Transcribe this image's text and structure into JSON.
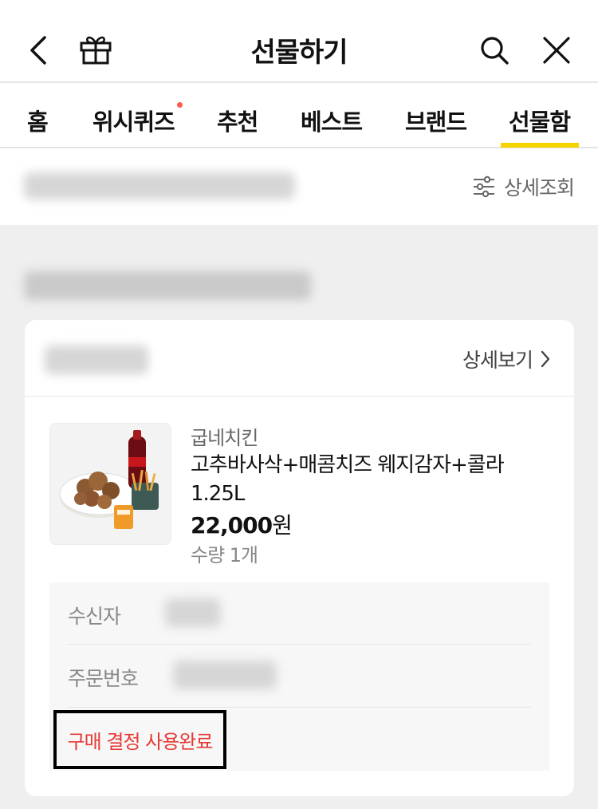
{
  "header": {
    "title": "선물하기",
    "back_icon": "chevron-left-icon",
    "gift_icon": "gift-icon",
    "search_icon": "search-icon",
    "close_icon": "close-icon"
  },
  "tabs": [
    {
      "label": "홈"
    },
    {
      "label": "위시퀴즈",
      "badge": true
    },
    {
      "label": "추천"
    },
    {
      "label": "베스트"
    },
    {
      "label": "브랜드"
    },
    {
      "label": "선물함",
      "active": true
    }
  ],
  "filter": {
    "label": "상세조회",
    "icon": "sliders-icon"
  },
  "order_card": {
    "detail_label": "상세보기",
    "brand": "굽네치킨",
    "product_name": "고추바사삭+매콤치즈 웨지감자+콜라 1.25L",
    "price_number": "22,000",
    "price_unit": "원",
    "quantity": "수량 1개",
    "recipient_label": "수신자",
    "order_number_label": "주문번호",
    "status": "구매 결정 사용완료"
  },
  "colors": {
    "accent_yellow": "#f5d300",
    "status_red": "#e53935",
    "badge_red": "#ff5a4e"
  }
}
